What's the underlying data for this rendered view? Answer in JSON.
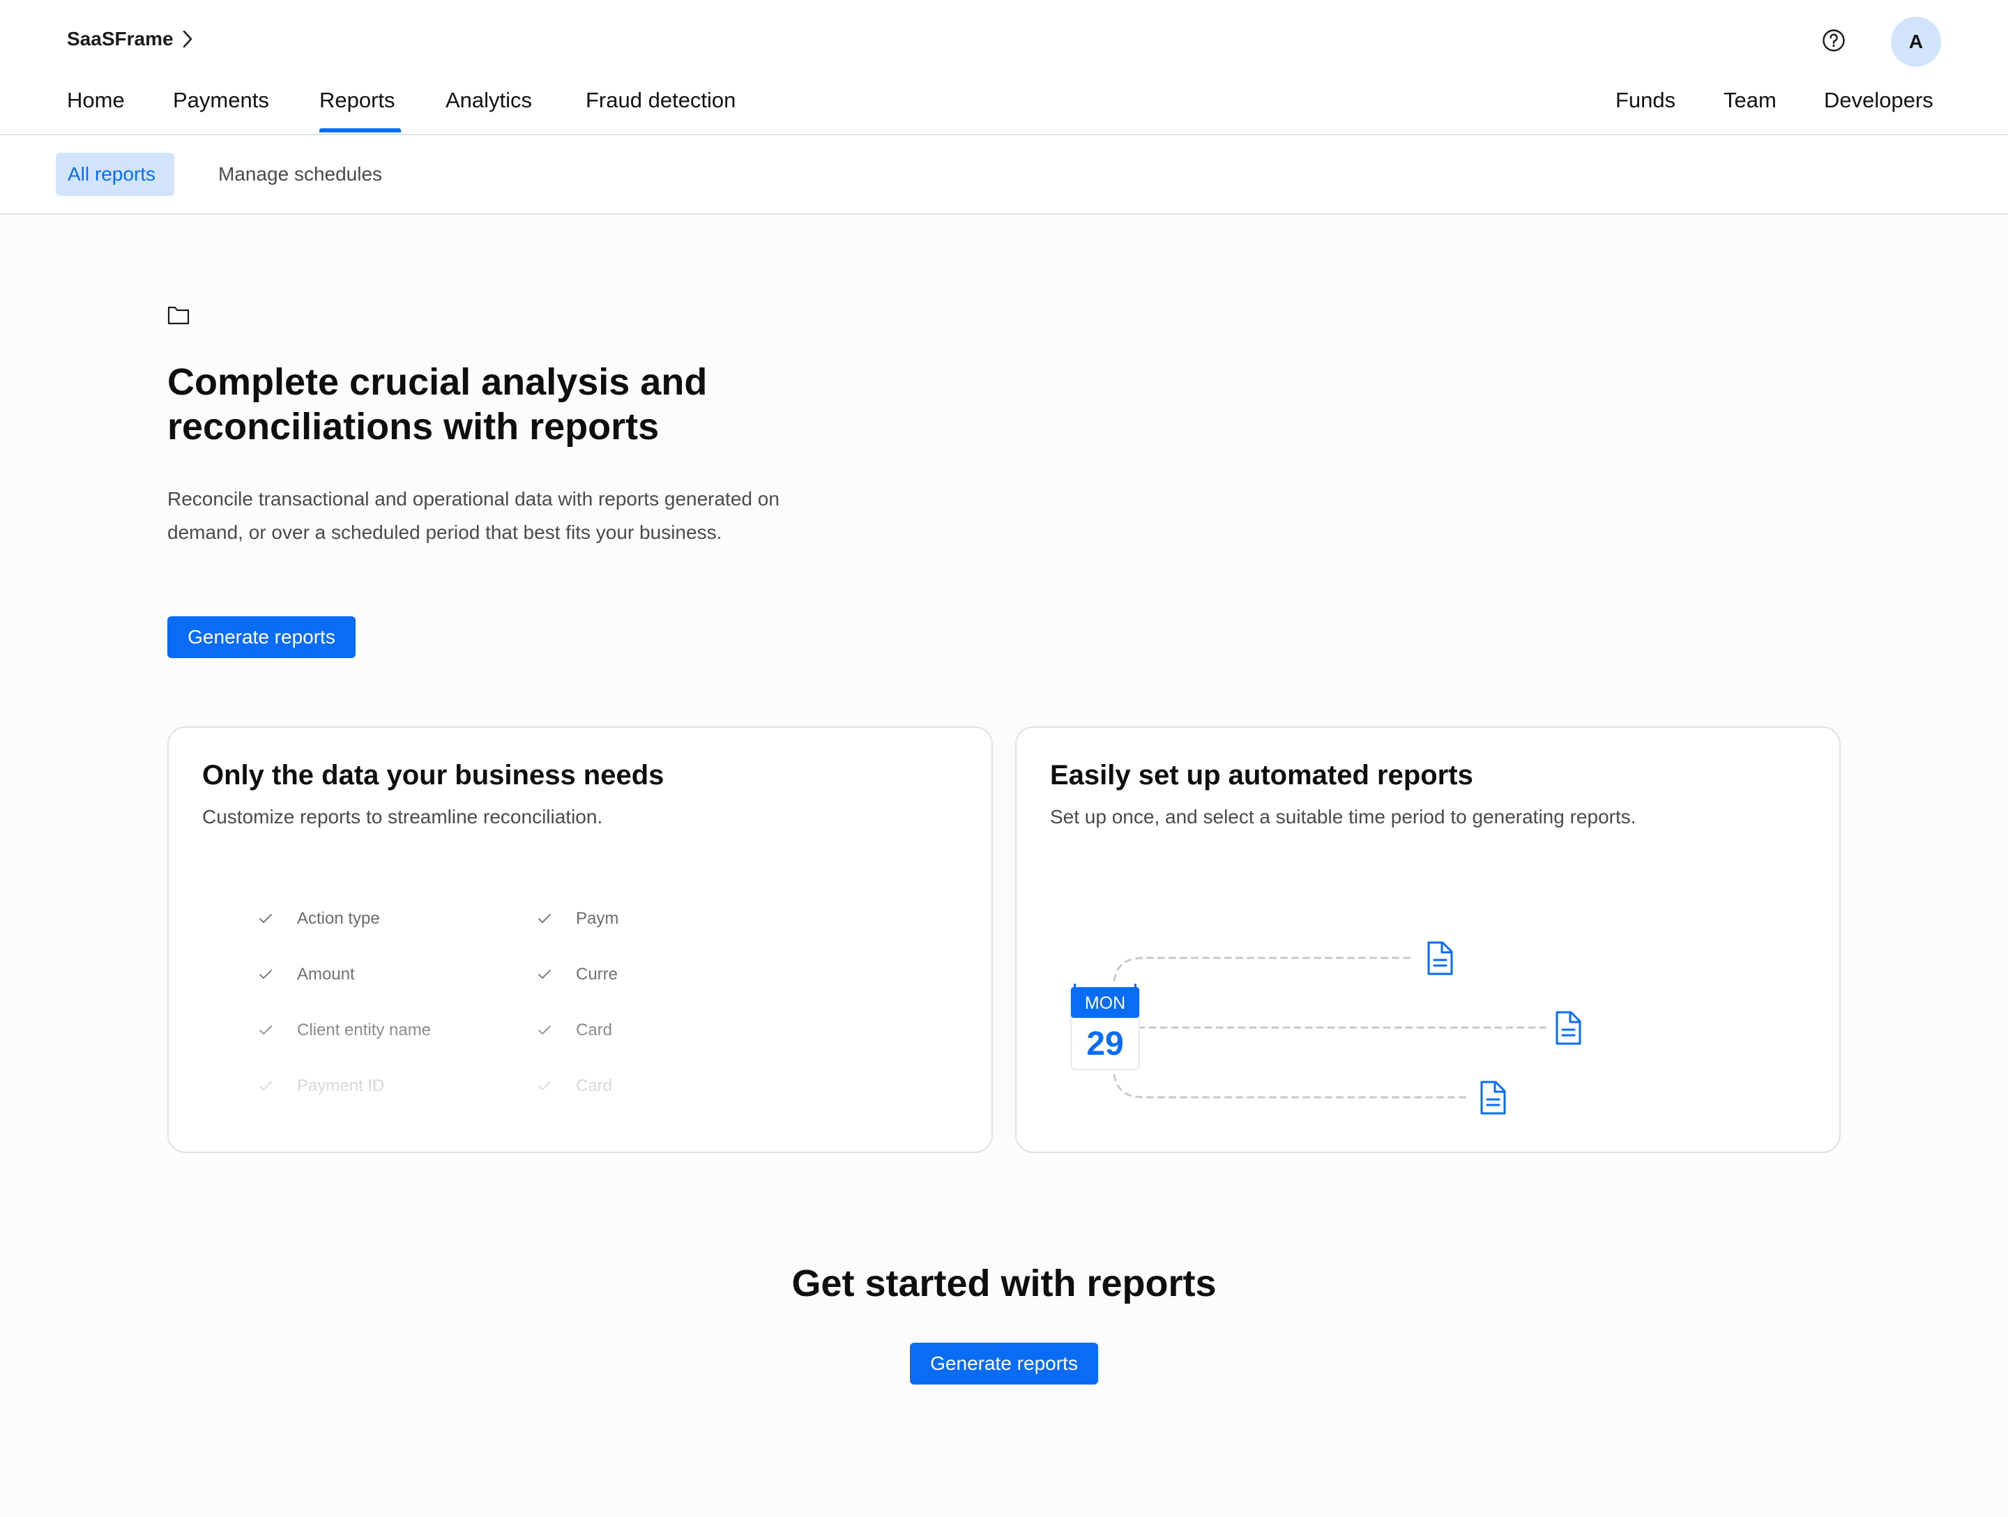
{
  "app": {
    "name": "SaaSFrame"
  },
  "header": {
    "avatar_initial": "A",
    "nav_left": [
      "Home",
      "Payments",
      "Reports",
      "Analytics",
      "Fraud detection"
    ],
    "nav_right": [
      "Funds",
      "Team",
      "Developers"
    ],
    "active_nav": "Reports"
  },
  "subnav": {
    "tabs": [
      "All reports",
      "Manage schedules"
    ],
    "active": "All reports"
  },
  "hero": {
    "title": "Complete crucial analysis and reconciliations with reports",
    "description": "Reconcile transactional and operational data with reports generated on demand, or over a scheduled period that best fits your business.",
    "cta": "Generate reports"
  },
  "cards": {
    "data": {
      "title": "Only the data your business needs",
      "description": "Customize reports to streamline reconciliation.",
      "fields_left": [
        "Action type",
        "Amount",
        "Client entity name",
        "Payment ID"
      ],
      "fields_right": [
        "Paym",
        "Curre",
        "Card",
        "Card"
      ]
    },
    "automated": {
      "title": "Easily set up automated reports",
      "description": "Set up once, and select a suitable time period to generating reports.",
      "calendar_day": "MON",
      "calendar_date": "29"
    }
  },
  "footer_cta": {
    "title": "Get started with reports",
    "button": "Generate reports"
  },
  "colors": {
    "accent": "#0a6cf5",
    "accent_light": "#d2e4fb"
  }
}
